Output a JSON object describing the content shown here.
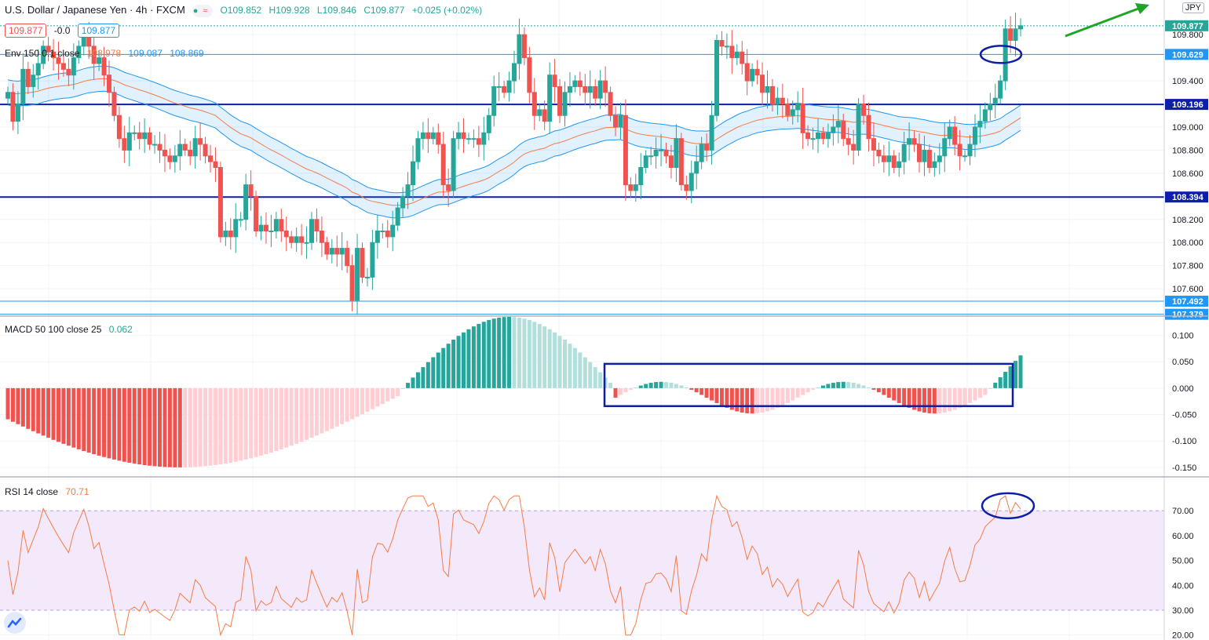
{
  "header": {
    "symbol_title": "U.S. Dollar / Japanese Yen · 4h · FXCM",
    "ohlc": {
      "o": "O109.852",
      "h": "H109.928",
      "l": "L109.846",
      "c": "C109.877",
      "chg": "+0.025 (+0.02%)"
    },
    "sell_price": "109.877",
    "spread": "-0.0",
    "buy_price": "109.877",
    "currency": "JPY"
  },
  "env_legend": {
    "label": "Env 150 0.1 close",
    "v1": "108.978",
    "v2": "109.087",
    "v3": "108.869"
  },
  "macd_legend": {
    "label": "MACD 50 100 close 25",
    "value": "0.062"
  },
  "rsi_legend": {
    "label": "RSI 14 close",
    "value": "70.71"
  },
  "colors": {
    "up": "#26a69a",
    "down": "#ef5350",
    "env_basis": "#f57c45",
    "env_band": "#2196f3",
    "hline": "#0d1fa8",
    "hline_thin": "#2196f3",
    "annotation": "#0d1fa8",
    "arrow": "#1ea526",
    "rsi_bg": "#f4e9fb",
    "rsi_line": "#f57c45",
    "macd_up_strong": "#26a69a",
    "macd_up_weak": "#b2dfdb",
    "macd_down_strong": "#ef5350",
    "macd_down_weak": "#ffcdd2"
  },
  "chart_data": [
    {
      "type": "candlestick",
      "title": "U.S. Dollar / Japanese Yen · 4h · FXCM",
      "ylim": [
        107.37,
        110.1
      ],
      "y_ticks": [
        "109.800",
        "109.400",
        "109.000",
        "108.800",
        "108.600",
        "108.200",
        "108.000",
        "107.800",
        "107.600"
      ],
      "price_labels": [
        {
          "value": 109.877,
          "label": "109.877",
          "style": "last"
        },
        {
          "value": 109.629,
          "label": "109.629",
          "style": "level"
        },
        {
          "value": 109.196,
          "label": "109.196",
          "style": "hline"
        },
        {
          "value": 108.394,
          "label": "108.394",
          "style": "hline"
        },
        {
          "value": 107.492,
          "label": "107.492",
          "style": "level"
        },
        {
          "value": 107.379,
          "label": "107.379",
          "style": "level"
        }
      ],
      "close_series_approx": [
        109.3,
        109.05,
        109.2,
        109.5,
        109.35,
        109.45,
        109.55,
        109.7,
        109.65,
        109.6,
        109.55,
        109.5,
        109.45,
        109.6,
        109.7,
        109.8,
        109.7,
        109.55,
        109.6,
        109.45,
        109.3,
        109.1,
        108.9,
        108.8,
        108.95,
        108.95,
        108.9,
        108.95,
        108.85,
        108.85,
        108.8,
        108.75,
        108.7,
        108.75,
        108.85,
        108.8,
        108.75,
        108.9,
        108.85,
        108.75,
        108.7,
        108.65,
        108.05,
        108.1,
        108.05,
        108.2,
        108.2,
        108.5,
        108.4,
        108.1,
        108.15,
        108.1,
        108.1,
        108.2,
        108.1,
        108.05,
        108.0,
        108.05,
        108.0,
        108.0,
        108.2,
        108.1,
        108.0,
        107.9,
        107.95,
        107.9,
        107.95,
        107.8,
        107.5,
        107.95,
        107.7,
        107.7,
        108.0,
        108.1,
        108.1,
        108.05,
        108.15,
        108.3,
        108.4,
        108.5,
        108.7,
        108.9,
        108.95,
        108.9,
        108.95,
        108.85,
        108.5,
        108.45,
        108.9,
        108.95,
        108.9,
        108.9,
        108.9,
        108.85,
        108.95,
        109.1,
        109.35,
        109.35,
        109.3,
        109.4,
        109.55,
        109.8,
        109.6,
        109.3,
        109.1,
        109.15,
        109.05,
        109.45,
        109.35,
        109.1,
        109.3,
        109.35,
        109.4,
        109.35,
        109.3,
        109.35,
        109.25,
        109.4,
        109.3,
        109.1,
        109.0,
        109.1,
        108.5,
        108.45,
        108.5,
        108.65,
        108.75,
        108.75,
        108.8,
        108.8,
        108.75,
        108.65,
        108.9,
        108.5,
        108.45,
        108.6,
        108.7,
        108.85,
        108.8,
        109.1,
        109.75,
        109.7,
        109.7,
        109.6,
        109.65,
        109.55,
        109.4,
        109.5,
        109.45,
        109.3,
        109.35,
        109.2,
        109.25,
        109.2,
        109.1,
        109.15,
        109.2,
        108.95,
        108.9,
        108.9,
        108.95,
        108.9,
        108.95,
        109.0,
        109.05,
        108.9,
        108.85,
        108.8,
        109.2,
        109.1,
        108.9,
        108.8,
        108.75,
        108.7,
        108.75,
        108.65,
        108.7,
        108.85,
        108.9,
        108.85,
        108.7,
        108.8,
        108.65,
        108.7,
        108.75,
        108.9,
        109.0,
        108.85,
        108.75,
        108.75,
        108.85,
        109.0,
        109.05,
        109.15,
        109.2,
        109.25,
        109.4,
        109.85,
        109.75,
        109.85,
        109.877
      ],
      "envelope": {
        "basis_last": 108.978,
        "upper_last": 109.087,
        "lower_last": 108.869
      }
    },
    {
      "type": "bar",
      "title": "MACD 50 100 close 25",
      "ylim": [
        -0.165,
        0.135
      ],
      "y_ticks": [
        "0.100",
        "0.050",
        "0.000",
        "-0.050",
        "-0.100",
        "-0.150"
      ],
      "last_value": 0.062
    },
    {
      "type": "line",
      "title": "RSI 14 close",
      "ylim": [
        18,
        83
      ],
      "y_ticks": [
        "70.00",
        "60.00",
        "50.00",
        "40.00",
        "30.00",
        "20.00"
      ],
      "bands": [
        30,
        70
      ],
      "last_value": 70.71
    }
  ]
}
